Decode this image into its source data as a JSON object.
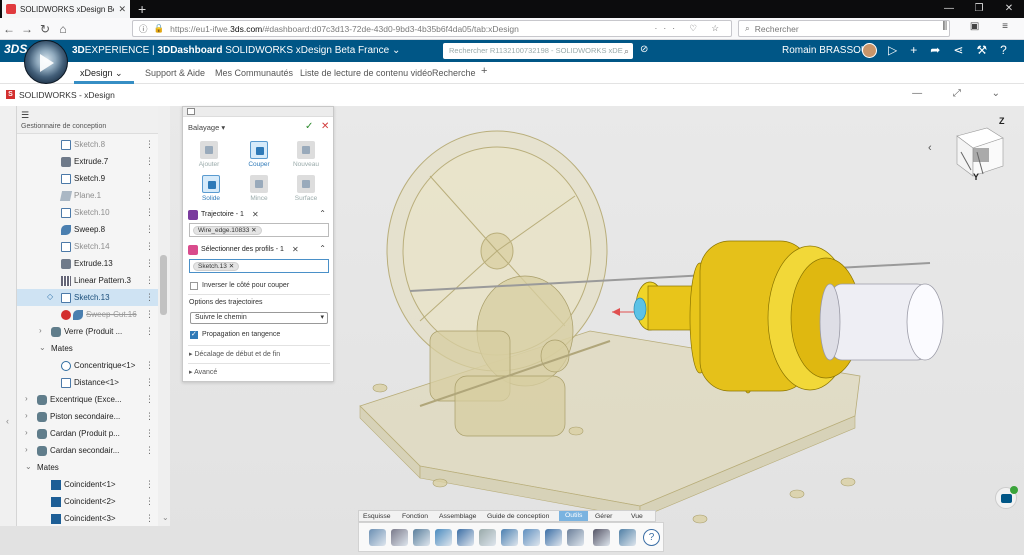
{
  "browser": {
    "tab_title": "SOLIDWORKS xDesign Beta Fra",
    "tab_close": "✕",
    "new_tab": "+",
    "url_prefix": "https://eu1-ifwe.",
    "url_domain": "3ds.com",
    "url_rest": "/#dashboard:d07c3d13-72de-43d0-9bd3-4b35b6f4da05/tab:xDesign",
    "search_placeholder": "Rechercher",
    "win_min": "—",
    "win_max": "❐",
    "win_close": "✕"
  },
  "header": {
    "brand_bold": "3D",
    "brand_rest": "EXPERIENCE | ",
    "dashboard_bold": "3DDashboard",
    "dashboard_rest": " SOLIDWORKS xDesign Beta France",
    "caret": "⌄",
    "search_placeholder": "Rechercher R1132100732198 - SOLIDWORKS xDE",
    "user": "Romain BRASSOUD"
  },
  "app_tabs": [
    "xDesign",
    "Support & Aide",
    "Mes Communautés",
    "Liste de lecture de contenu vidéo",
    "Recherche",
    "+"
  ],
  "app": {
    "title": "SOLIDWORKS - xDesign",
    "icon_letter": "S"
  },
  "tree": {
    "title": "Gestionnaire de conception",
    "items": [
      {
        "label": "Sketch.8",
        "type": "sketch",
        "state": "dim"
      },
      {
        "label": "Extrude.7",
        "type": "extrude",
        "state": "normal"
      },
      {
        "label": "Sketch.9",
        "type": "sketch",
        "state": "normal"
      },
      {
        "label": "Plane.1",
        "type": "plane",
        "state": "dim"
      },
      {
        "label": "Sketch.10",
        "type": "sketch",
        "state": "dim"
      },
      {
        "label": "Sweep.8",
        "type": "sweep",
        "state": "normal"
      },
      {
        "label": "Sketch.14",
        "type": "sketch",
        "state": "dim"
      },
      {
        "label": "Extrude.13",
        "type": "extrude",
        "state": "normal"
      },
      {
        "label": "Linear Pattern.3",
        "type": "pattern",
        "state": "normal"
      },
      {
        "label": "Sketch.13",
        "type": "sketch",
        "state": "selected"
      },
      {
        "label": "Sweep-Cut.16",
        "type": "sweepcut",
        "state": "error"
      },
      {
        "label": "Verre (Produit ...",
        "type": "assembly",
        "state": "normal"
      },
      {
        "label": "Mates",
        "type": "group",
        "state": "normal"
      },
      {
        "label": "Concentrique<1>",
        "type": "mate",
        "state": "normal"
      },
      {
        "label": "Distance<1>",
        "type": "distance",
        "state": "normal"
      },
      {
        "label": "Excentrique (Exce...",
        "type": "assembly",
        "state": "normal"
      },
      {
        "label": "Piston secondaire...",
        "type": "assembly",
        "state": "normal"
      },
      {
        "label": "Cardan (Produit p...",
        "type": "assembly",
        "state": "normal"
      },
      {
        "label": "Cardan secondair...",
        "type": "assembly",
        "state": "normal"
      },
      {
        "label": "Mates",
        "type": "group",
        "state": "normal"
      },
      {
        "label": "Coincident<1>",
        "type": "coincident",
        "state": "normal"
      },
      {
        "label": "Coincident<2>",
        "type": "coincident",
        "state": "normal"
      },
      {
        "label": "Coincident<3>",
        "type": "coincident",
        "state": "normal"
      }
    ]
  },
  "dialog": {
    "title": "Balayage",
    "title_caret": "▾",
    "ok": "✓",
    "cancel": "✕",
    "tools": [
      {
        "label": "Ajouter",
        "active": false
      },
      {
        "label": "Couper",
        "active": true
      },
      {
        "label": "Nouveau",
        "active": false
      },
      {
        "label": "Solide",
        "active": true
      },
      {
        "label": "Mince",
        "active": false
      },
      {
        "label": "Surface",
        "active": false
      }
    ],
    "trajectory_label": "Trajectoire - 1",
    "trajectory_chip": "Wire_edge.10833",
    "profiles_label": "Sélectionner des profils - 1",
    "profiles_chip": "Sketch.13",
    "chip_close": "✕",
    "invert_label": "Inverser le côté pour couper",
    "options_title": "Options des trajectoires",
    "dropdown_value": "Suivre le chemin",
    "tangent_label": "Propagation en tangence",
    "offset_label": "Décalage de début et de fin",
    "advanced_label": "Avancé",
    "expand_caret": "▸"
  },
  "viewcube": {
    "z": "Z",
    "y": "Y",
    "prev": "‹"
  },
  "bottom_tabs": [
    "Esquisse",
    "Fonction",
    "Assemblage",
    "Guide de conception",
    "Outils",
    "Gérer",
    "Vue"
  ],
  "bottom_active": "Outils",
  "help_icon_label": "?",
  "colors": {
    "header_blue": "#005686",
    "accent": "#368ec4",
    "gold": "#e8c51a",
    "transparent_body": "#ddd6b0"
  }
}
